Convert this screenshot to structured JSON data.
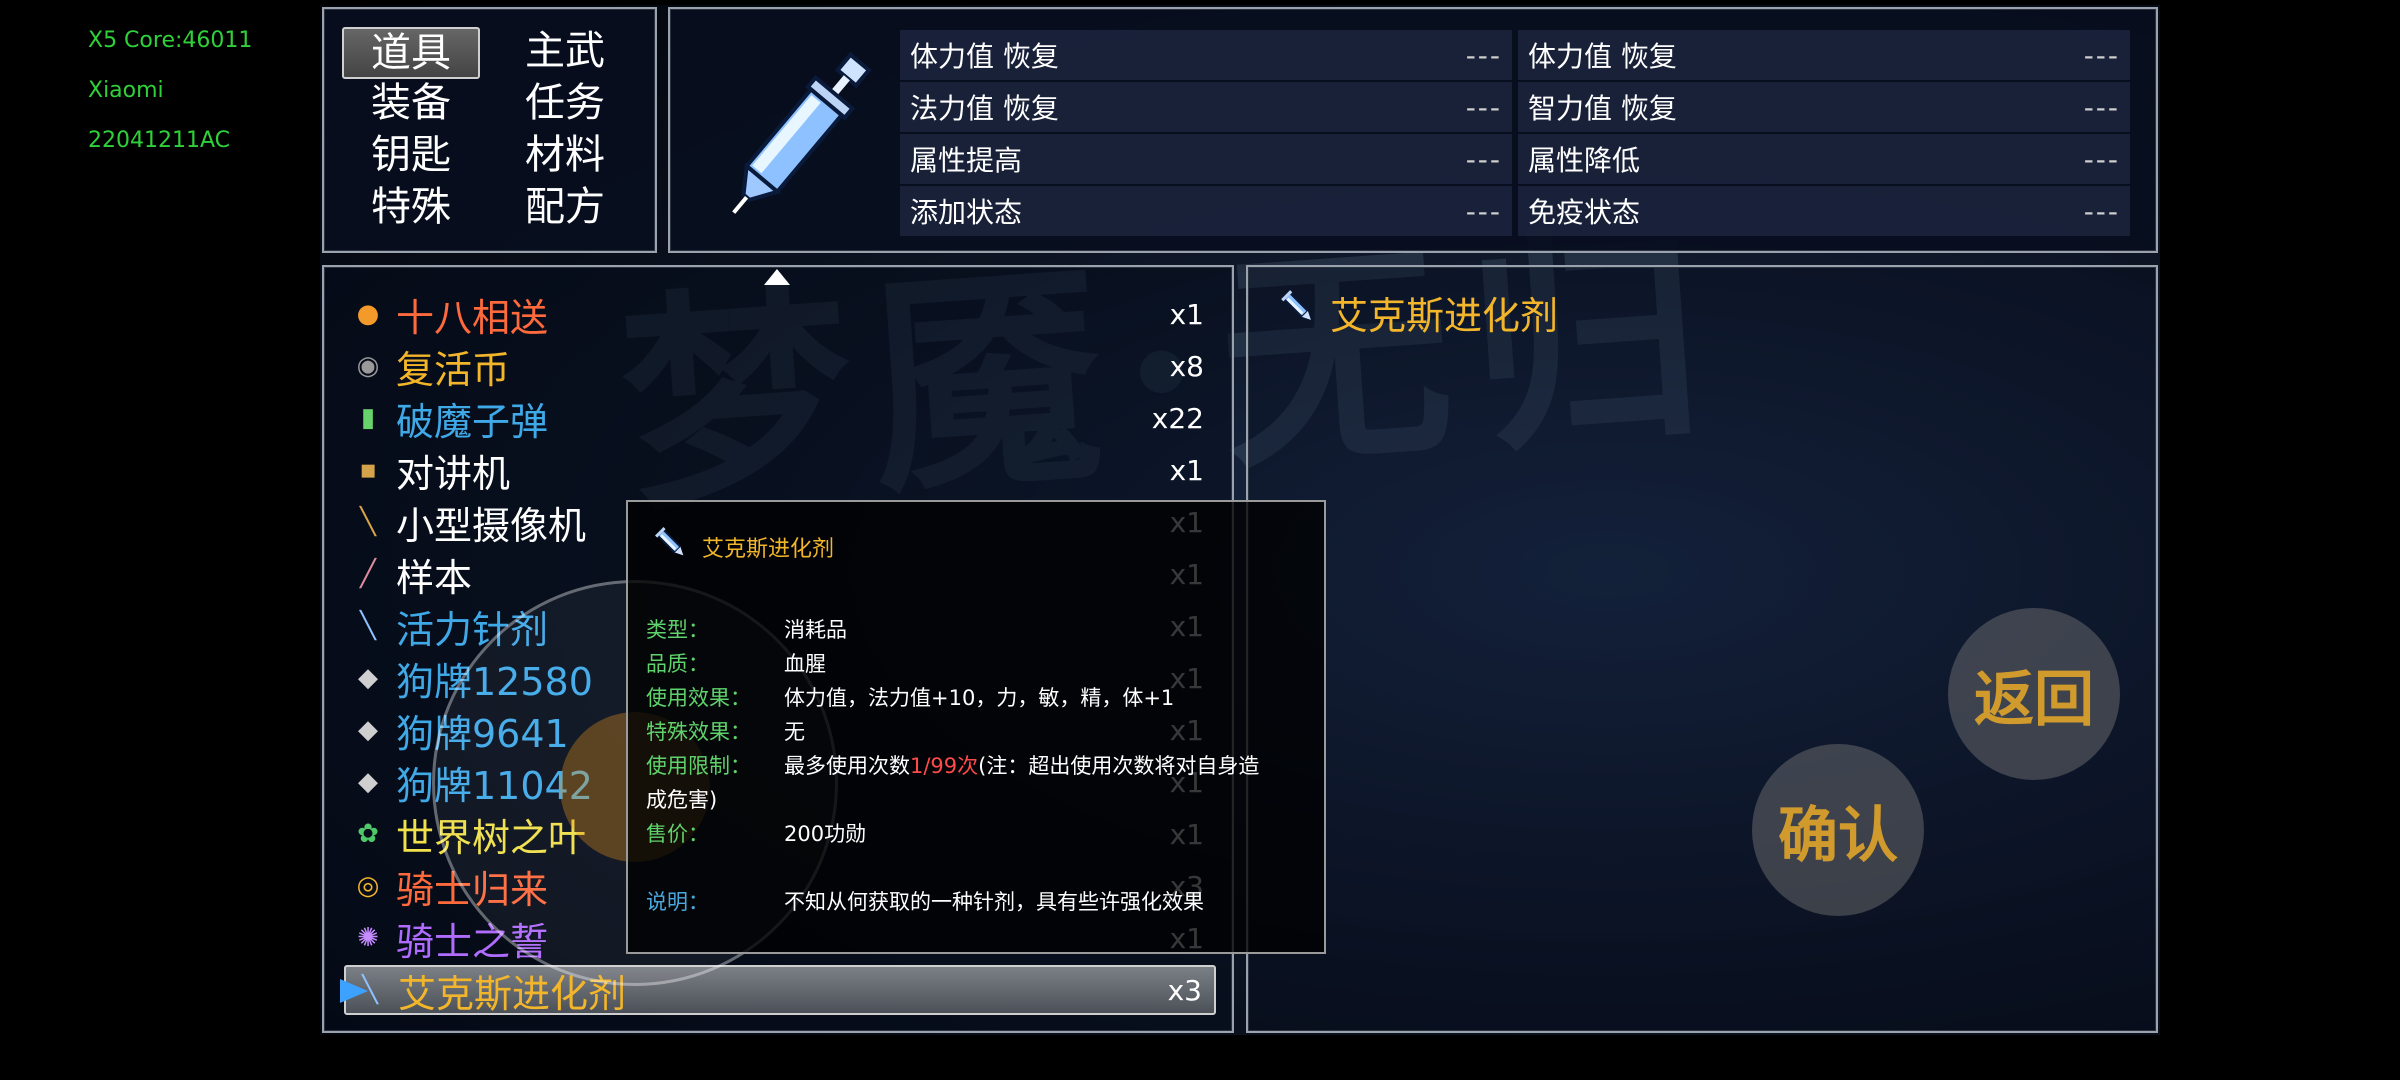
{
  "debug": [
    "X5 Core:46011",
    "Xiaomi",
    "22041211AC"
  ],
  "watermark": "梦魇·无归",
  "categories": [
    {
      "label": "道具",
      "selected": true
    },
    {
      "label": "主武",
      "selected": false
    },
    {
      "label": "装备",
      "selected": false
    },
    {
      "label": "任务",
      "selected": false
    },
    {
      "label": "钥匙",
      "selected": false
    },
    {
      "label": "材料",
      "selected": false
    },
    {
      "label": "特殊",
      "selected": false
    },
    {
      "label": "配方",
      "selected": false
    }
  ],
  "status": [
    {
      "label": "体力值 恢复",
      "value": "---"
    },
    {
      "label": "体力值 恢复",
      "value": "---"
    },
    {
      "label": "法力值 恢复",
      "value": "---"
    },
    {
      "label": "智力值 恢复",
      "value": "---"
    },
    {
      "label": "属性提高",
      "value": "---"
    },
    {
      "label": "属性降低",
      "value": "---"
    },
    {
      "label": "添加状态",
      "value": "---"
    },
    {
      "label": "免疫状态",
      "value": "---"
    }
  ],
  "items": [
    {
      "name": "十八相送",
      "count": "x1",
      "color": "#ff6a3d",
      "icon": "medal-icon"
    },
    {
      "name": "复活币",
      "count": "x8",
      "color": "#f3b62b",
      "icon": "coin-icon"
    },
    {
      "name": "破魔子弹",
      "count": "x22",
      "color": "#3fa9e8",
      "icon": "bullet-icon"
    },
    {
      "name": "对讲机",
      "count": "x1",
      "color": "#ffffff",
      "icon": "radio-icon"
    },
    {
      "name": "小型摄像机",
      "count": "x1",
      "color": "#ffffff",
      "icon": "camera-icon"
    },
    {
      "name": "样本",
      "count": "x1",
      "color": "#ffffff",
      "icon": "sample-icon"
    },
    {
      "name": "活力针剂",
      "count": "x1",
      "color": "#3fa9e8",
      "icon": "syringe-icon"
    },
    {
      "name": "狗牌12580",
      "count": "x1",
      "color": "#3fa9e8",
      "icon": "dogtag-icon"
    },
    {
      "name": "狗牌9641",
      "count": "x1",
      "color": "#3fa9e8",
      "icon": "dogtag-icon"
    },
    {
      "name": "狗牌11042",
      "count": "x1",
      "color": "#3fa9e8",
      "icon": "dogtag-icon"
    },
    {
      "name": "世界树之叶",
      "count": "x1",
      "color": "#f0e04a",
      "icon": "leaf-icon"
    },
    {
      "name": "骑士归来",
      "count": "x3",
      "color": "#ff6a3d",
      "icon": "eye-icon"
    },
    {
      "name": "骑士之誓",
      "count": "x1",
      "color": "#b06bff",
      "icon": "orb-icon"
    },
    {
      "name": "艾克斯进化剂",
      "count": "x3",
      "color": "#f3b62b",
      "icon": "syringe-icon",
      "selected": true
    }
  ],
  "detail": {
    "title": "艾克斯进化剂"
  },
  "tooltip": {
    "title": "艾克斯进化剂",
    "type_label": "类型：",
    "type_value": "消耗品",
    "quality_label": "品质：",
    "quality_value": "血腥",
    "effect_label": "使用效果：",
    "effect_value": "体力值，法力值+10，力，敏，精，体+1",
    "special_label": "特殊效果：",
    "special_value": "无",
    "limit_label": "使用限制：",
    "limit_prefix": "最多使用次数",
    "limit_count": "1/99次",
    "limit_suffix": "(注：超出使用次数将对自身造",
    "limit_line2": "成危害)",
    "price_label": "售价：",
    "price_value": "200功勋",
    "desc_label": "说明：",
    "desc_value": "不知从何获取的一种针剂，具有些许强化效果"
  },
  "buttons": {
    "back": "返回",
    "confirm": "确认"
  }
}
